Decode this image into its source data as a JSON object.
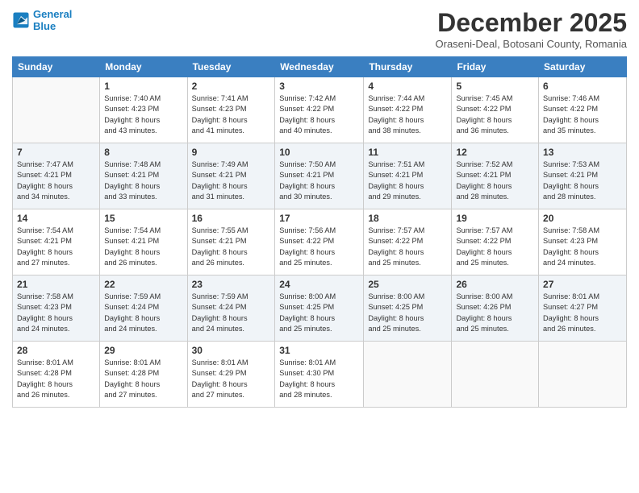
{
  "logo": {
    "line1": "General",
    "line2": "Blue"
  },
  "title": "December 2025",
  "location": "Oraseni-Deal, Botosani County, Romania",
  "days_header": [
    "Sunday",
    "Monday",
    "Tuesday",
    "Wednesday",
    "Thursday",
    "Friday",
    "Saturday"
  ],
  "weeks": [
    [
      {
        "num": "",
        "info": ""
      },
      {
        "num": "1",
        "info": "Sunrise: 7:40 AM\nSunset: 4:23 PM\nDaylight: 8 hours\nand 43 minutes."
      },
      {
        "num": "2",
        "info": "Sunrise: 7:41 AM\nSunset: 4:23 PM\nDaylight: 8 hours\nand 41 minutes."
      },
      {
        "num": "3",
        "info": "Sunrise: 7:42 AM\nSunset: 4:22 PM\nDaylight: 8 hours\nand 40 minutes."
      },
      {
        "num": "4",
        "info": "Sunrise: 7:44 AM\nSunset: 4:22 PM\nDaylight: 8 hours\nand 38 minutes."
      },
      {
        "num": "5",
        "info": "Sunrise: 7:45 AM\nSunset: 4:22 PM\nDaylight: 8 hours\nand 36 minutes."
      },
      {
        "num": "6",
        "info": "Sunrise: 7:46 AM\nSunset: 4:22 PM\nDaylight: 8 hours\nand 35 minutes."
      }
    ],
    [
      {
        "num": "7",
        "info": "Sunrise: 7:47 AM\nSunset: 4:21 PM\nDaylight: 8 hours\nand 34 minutes."
      },
      {
        "num": "8",
        "info": "Sunrise: 7:48 AM\nSunset: 4:21 PM\nDaylight: 8 hours\nand 33 minutes."
      },
      {
        "num": "9",
        "info": "Sunrise: 7:49 AM\nSunset: 4:21 PM\nDaylight: 8 hours\nand 31 minutes."
      },
      {
        "num": "10",
        "info": "Sunrise: 7:50 AM\nSunset: 4:21 PM\nDaylight: 8 hours\nand 30 minutes."
      },
      {
        "num": "11",
        "info": "Sunrise: 7:51 AM\nSunset: 4:21 PM\nDaylight: 8 hours\nand 29 minutes."
      },
      {
        "num": "12",
        "info": "Sunrise: 7:52 AM\nSunset: 4:21 PM\nDaylight: 8 hours\nand 28 minutes."
      },
      {
        "num": "13",
        "info": "Sunrise: 7:53 AM\nSunset: 4:21 PM\nDaylight: 8 hours\nand 28 minutes."
      }
    ],
    [
      {
        "num": "14",
        "info": "Sunrise: 7:54 AM\nSunset: 4:21 PM\nDaylight: 8 hours\nand 27 minutes."
      },
      {
        "num": "15",
        "info": "Sunrise: 7:54 AM\nSunset: 4:21 PM\nDaylight: 8 hours\nand 26 minutes."
      },
      {
        "num": "16",
        "info": "Sunrise: 7:55 AM\nSunset: 4:21 PM\nDaylight: 8 hours\nand 26 minutes."
      },
      {
        "num": "17",
        "info": "Sunrise: 7:56 AM\nSunset: 4:22 PM\nDaylight: 8 hours\nand 25 minutes."
      },
      {
        "num": "18",
        "info": "Sunrise: 7:57 AM\nSunset: 4:22 PM\nDaylight: 8 hours\nand 25 minutes."
      },
      {
        "num": "19",
        "info": "Sunrise: 7:57 AM\nSunset: 4:22 PM\nDaylight: 8 hours\nand 25 minutes."
      },
      {
        "num": "20",
        "info": "Sunrise: 7:58 AM\nSunset: 4:23 PM\nDaylight: 8 hours\nand 24 minutes."
      }
    ],
    [
      {
        "num": "21",
        "info": "Sunrise: 7:58 AM\nSunset: 4:23 PM\nDaylight: 8 hours\nand 24 minutes."
      },
      {
        "num": "22",
        "info": "Sunrise: 7:59 AM\nSunset: 4:24 PM\nDaylight: 8 hours\nand 24 minutes."
      },
      {
        "num": "23",
        "info": "Sunrise: 7:59 AM\nSunset: 4:24 PM\nDaylight: 8 hours\nand 24 minutes."
      },
      {
        "num": "24",
        "info": "Sunrise: 8:00 AM\nSunset: 4:25 PM\nDaylight: 8 hours\nand 25 minutes."
      },
      {
        "num": "25",
        "info": "Sunrise: 8:00 AM\nSunset: 4:25 PM\nDaylight: 8 hours\nand 25 minutes."
      },
      {
        "num": "26",
        "info": "Sunrise: 8:00 AM\nSunset: 4:26 PM\nDaylight: 8 hours\nand 25 minutes."
      },
      {
        "num": "27",
        "info": "Sunrise: 8:01 AM\nSunset: 4:27 PM\nDaylight: 8 hours\nand 26 minutes."
      }
    ],
    [
      {
        "num": "28",
        "info": "Sunrise: 8:01 AM\nSunset: 4:28 PM\nDaylight: 8 hours\nand 26 minutes."
      },
      {
        "num": "29",
        "info": "Sunrise: 8:01 AM\nSunset: 4:28 PM\nDaylight: 8 hours\nand 27 minutes."
      },
      {
        "num": "30",
        "info": "Sunrise: 8:01 AM\nSunset: 4:29 PM\nDaylight: 8 hours\nand 27 minutes."
      },
      {
        "num": "31",
        "info": "Sunrise: 8:01 AM\nSunset: 4:30 PM\nDaylight: 8 hours\nand 28 minutes."
      },
      {
        "num": "",
        "info": ""
      },
      {
        "num": "",
        "info": ""
      },
      {
        "num": "",
        "info": ""
      }
    ]
  ]
}
